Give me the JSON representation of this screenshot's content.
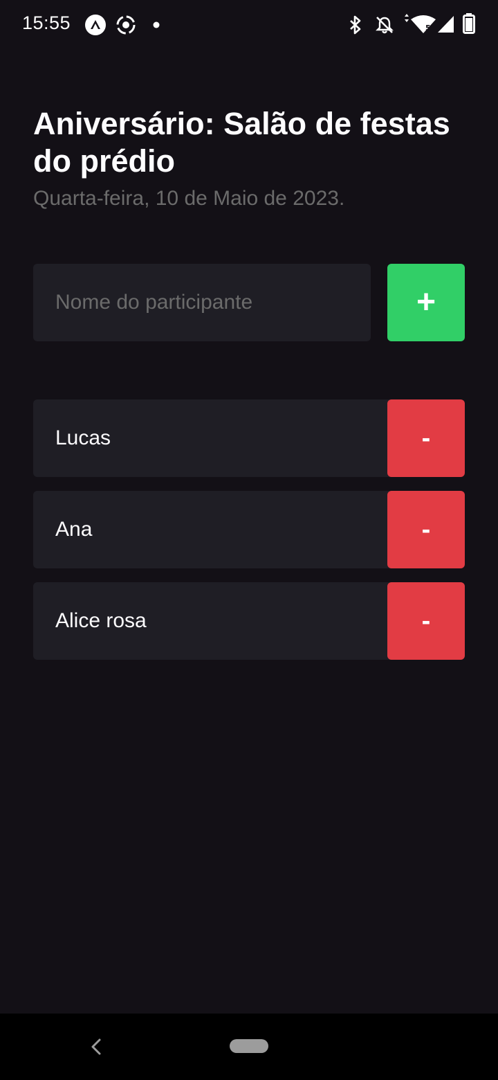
{
  "status_bar": {
    "time": "15:55",
    "notification_icons": [
      "expo-icon",
      "target-icon",
      "dot-icon"
    ],
    "system_icons": [
      "bluetooth-icon",
      "notifications-off-icon",
      "wifi-icon",
      "signal-icon",
      "battery-icon"
    ]
  },
  "event": {
    "title": "Aniversário: Salão de festas do prédio",
    "date": "Quarta-feira, 10 de Maio de 2023."
  },
  "form": {
    "placeholder": "Nome do participante",
    "value": "",
    "add_label": "+"
  },
  "participants": [
    {
      "name": "Lucas",
      "remove_label": "-"
    },
    {
      "name": "Ana",
      "remove_label": "-"
    },
    {
      "name": "Alice rosa",
      "remove_label": "-"
    }
  ],
  "nav": {
    "back_label": "‹"
  },
  "colors": {
    "background": "#131016",
    "card": "#1f1e25",
    "accent_add": "#31cf67",
    "accent_remove": "#e23c44",
    "muted_text": "#6b6b6b"
  }
}
